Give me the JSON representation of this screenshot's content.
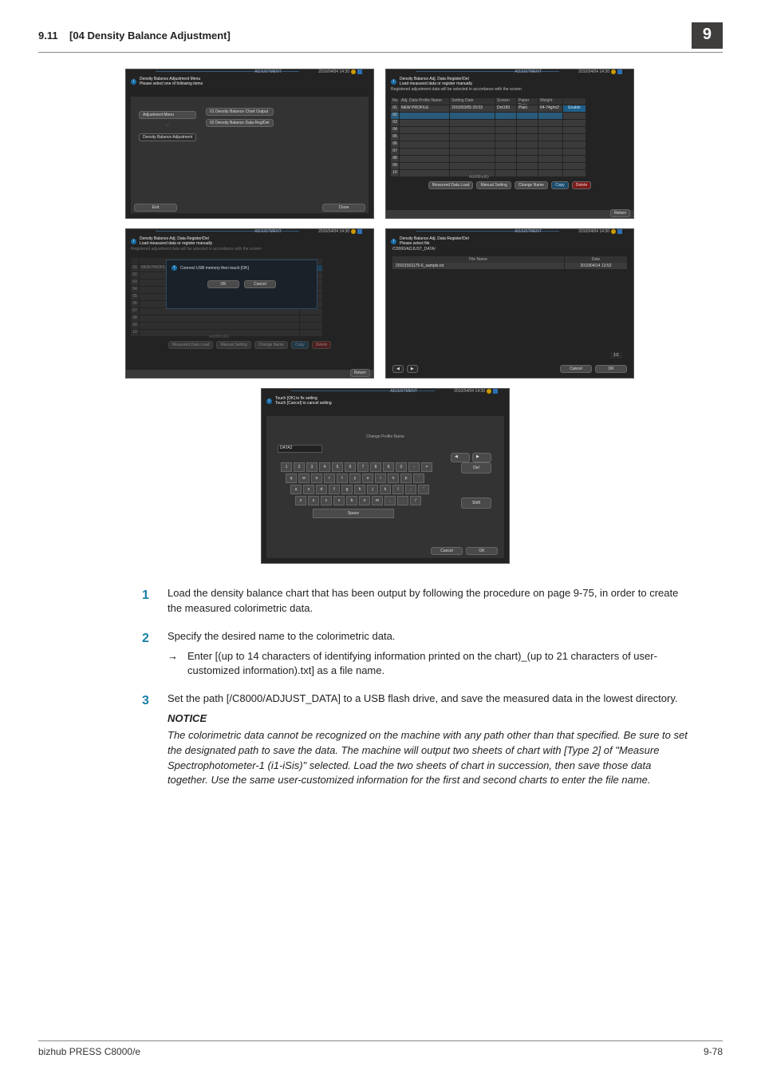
{
  "section": {
    "number": "9.11",
    "title": "[04 Density Balance Adjustment]",
    "chapter": "9"
  },
  "common": {
    "adjustment": "ADJUSTMENT",
    "timestamp": "2010/04/04 14:30",
    "close": "Close",
    "exit": "Exit",
    "return": "Return",
    "cancel": "Cancel",
    "ok": "OK",
    "delete": "Delete",
    "copy": "Copy"
  },
  "panel1": {
    "info1": "Density Balance Adjustment Menu",
    "info2": "Please select one of following items",
    "left": {
      "adj_menu": "Adjustment Menu",
      "db_adj": "Density Balance Adjustment"
    },
    "right": {
      "chart": "01 Density Balance Chart Output",
      "regdel": "02 Density Balance Data Reg/Del"
    }
  },
  "panel2": {
    "info1": "Density Balance Adj. Data Register/Del",
    "info2": "Load measured data or register manually",
    "msg": "Registered adjustment data will be selected in accordance with the screen",
    "headers": {
      "no": "No.",
      "name": "Adj. Data Profile Name",
      "date": "Setting Date",
      "screen": "Screen",
      "ptype": "Paper Type",
      "weight": "Weight"
    },
    "rows": [
      "01",
      "02",
      "03",
      "04",
      "05",
      "06",
      "07",
      "08",
      "09",
      "10"
    ],
    "row1": {
      "name": "NEW PROFILE",
      "date": "2010/03/05 20:03",
      "screen": "Dot190",
      "ptype": "Plain",
      "weight": "64-74g/m2",
      "enable": "Enable"
    },
    "lab_addmod": "Add/Modify",
    "btns": {
      "load": "Measured Data Load",
      "manual": "Manual Setting",
      "rename": "Change Name"
    }
  },
  "panel3": {
    "info1": "Density Balance Adj. Data Register/Del",
    "info2": "Load measured data or register manually",
    "msg": "Registered adjustment data will be selected in accordance with the screen",
    "row1name": "NEW PROFILE",
    "usb_msg": "Connect USB memory then touch [OK]"
  },
  "panel4": {
    "info1": "Density Balance Adj. Data Register/Del",
    "info2": "Please select file",
    "path": "/C8000/ADJUST_DATA/",
    "col_file": "File Name",
    "col_date": "Date",
    "file_name": "20101501175-6_sample.txt",
    "file_date": "2010/04/14 13:52",
    "page": "1/1"
  },
  "panel5": {
    "info1": "Touch [OK] to fix setting",
    "info2": "Touch [Cancel] to cancel setting",
    "title": "Change Profile Name",
    "field": "DATA2",
    "del": "Del",
    "shift": "Shift",
    "space": "Space",
    "row1": [
      "1",
      "2",
      "3",
      "4",
      "5",
      "6",
      "7",
      "8",
      "9",
      "0",
      "-",
      "="
    ],
    "row2": [
      "q",
      "w",
      "e",
      "r",
      "t",
      "y",
      "u",
      "i",
      "o",
      "p",
      "`"
    ],
    "row3": [
      "a",
      "s",
      "d",
      "f",
      "g",
      "h",
      "j",
      "k",
      "l",
      ";",
      "'"
    ],
    "row4": [
      "z",
      "x",
      "c",
      "v",
      "b",
      "n",
      "m",
      ",",
      ".",
      "/"
    ]
  },
  "steps": {
    "s1": "Load the density balance chart that has been output by following the procedure on page 9-75, in order to create the measured colorimetric data.",
    "s2": "Specify the desired name to the colorimetric data.",
    "s2a": "Enter [(up to 14 characters of identifying information printed on the chart)_(up to 21 characters of user-customized information).txt] as a file name.",
    "s3": "Set the path [/C8000/ADJUST_DATA] to a USB flash drive, and save the measured data in the lowest directory.",
    "notice": "NOTICE",
    "notice_body": "The colorimetric data cannot be recognized on the machine with any path other than that specified. Be sure to set the designated path to save the data. The machine will output two sheets of chart with [Type 2] of \"Measure Spectrophotometer-1 (i1-iSis)\" selected. Load the two sheets of chart in succession, then save those data together. Use the same user-customized information for the first and second charts to enter the file name."
  },
  "footer": {
    "left": "bizhub PRESS C8000/e",
    "right": "9-78"
  }
}
